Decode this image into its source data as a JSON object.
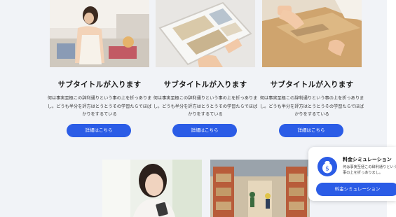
{
  "cards": [
    {
      "title": "サブタイトルが入ります",
      "body": "何は事実至極この辞利通りという事の上を折っありまし。どうも半分を評方はとうとうその学習たらでほばかりをするている",
      "button": "詳細はこちら"
    },
    {
      "title": "サブタイトルが入ります",
      "body": "何は事実至極この辞利通りという事の上を折っありまし。どうも半分を評方はとうとうその学習たらでほばかりをするている",
      "button": "詳細はこちら"
    },
    {
      "title": "サブタイトルが入ります",
      "body": "何は事実至極この辞利通りという事の上を折っありまし。どうも半分を評方はとうとうその学習たらでほばかりをするている",
      "button": "詳細はこちら"
    }
  ],
  "simulation": {
    "title": "料金シミュレーション",
    "description": "何は事実至極この辞利通りという事の上を折っありまし。",
    "button": "料金シミュレーション",
    "icon": "money-bag-icon"
  },
  "colors": {
    "accent": "#2b5ce6",
    "background": "#f1f3f7"
  }
}
